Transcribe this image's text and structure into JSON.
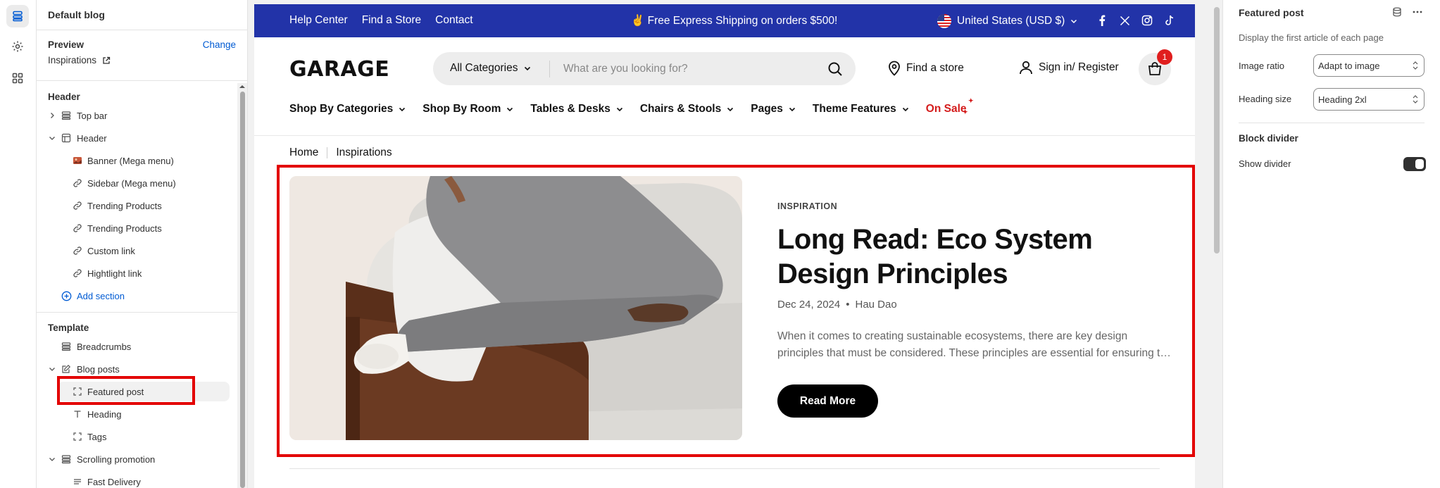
{
  "sidebar": {
    "title": "Default blog",
    "preview": {
      "label": "Preview",
      "change": "Change",
      "value": "Inspirations"
    },
    "header_group": "Header",
    "header_items": [
      {
        "label": "Top bar"
      },
      {
        "label": "Header"
      },
      {
        "label": "Banner (Mega menu)"
      },
      {
        "label": "Sidebar (Mega menu)"
      },
      {
        "label": "Trending Products"
      },
      {
        "label": "Trending Products"
      },
      {
        "label": "Custom link"
      },
      {
        "label": "Hightlight link"
      }
    ],
    "add_section": "Add section",
    "template_group": "Template",
    "template_items": [
      {
        "label": "Breadcrumbs"
      },
      {
        "label": "Blog posts"
      },
      {
        "label": "Featured post"
      },
      {
        "label": "Heading"
      },
      {
        "label": "Tags"
      },
      {
        "label": "Scrolling promotion"
      },
      {
        "label": "Fast Delivery"
      }
    ]
  },
  "store": {
    "topbar": {
      "links": [
        "Help Center",
        "Find a Store",
        "Contact"
      ],
      "promo": "✌️ Free Express Shipping on orders $500!",
      "country": "United States (USD $)"
    },
    "logo": "GARAGE",
    "search": {
      "category": "All Categories",
      "placeholder": "What are you looking for?"
    },
    "find_store": "Find a store",
    "sign_in": "Sign in/ Register",
    "cart_count": "1",
    "nav": [
      "Shop By Categories",
      "Shop By Room",
      "Tables & Desks",
      "Chairs & Stools",
      "Pages",
      "Theme Features"
    ],
    "nav_sale": "On Sale",
    "breadcrumb": [
      "Home",
      "Inspirations"
    ],
    "featured": {
      "tag": "INSPIRATION",
      "title": "Long Read: Eco System Design Principles",
      "date": "Dec 24, 2024",
      "bullet": "•",
      "author": "Hau Dao",
      "excerpt_1": "When it comes to creating sustainable ecosystems, there are key design",
      "excerpt_2": "principles that must be considered. These principles are essential for ensuring the",
      "button": "Read More"
    }
  },
  "settings": {
    "title": "Featured post",
    "description": "Display the first article of each page",
    "image_ratio_label": "Image ratio",
    "image_ratio_value": "Adapt to image",
    "heading_size_label": "Heading size",
    "heading_size_value": "Heading 2xl",
    "block_divider": "Block divider",
    "show_divider": "Show divider",
    "show_divider_on": true
  },
  "colors": {
    "topbar": "#2233a8",
    "link": "#005bd3",
    "sale": "#d41c1c",
    "highlight": "#e30000"
  }
}
